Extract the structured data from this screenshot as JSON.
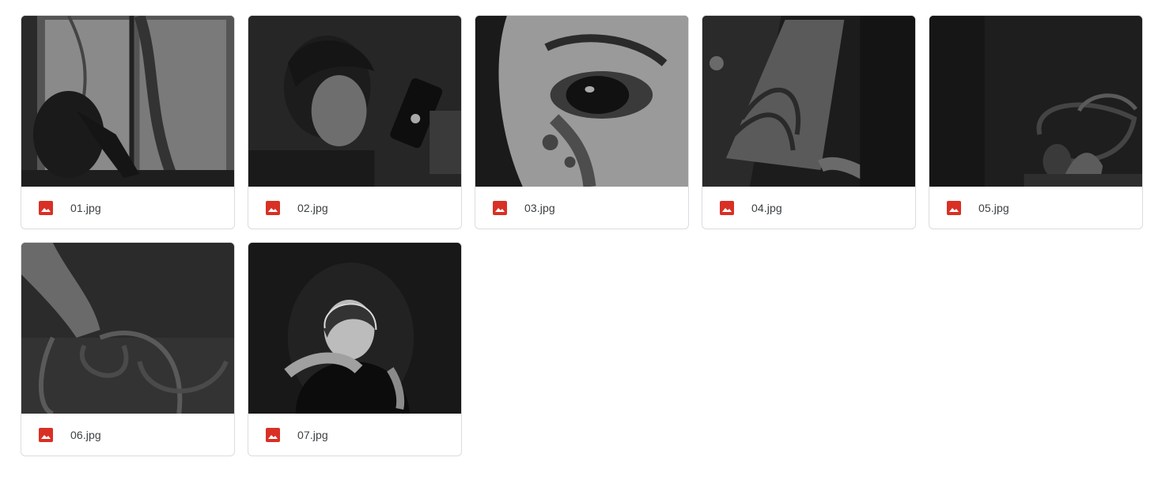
{
  "files": [
    {
      "name": "01.jpg",
      "icon": "image-file-icon",
      "thumbnail": "woman-sitting-by-window"
    },
    {
      "name": "02.jpg",
      "icon": "image-file-icon",
      "thumbnail": "person-lying-with-phone"
    },
    {
      "name": "03.jpg",
      "icon": "image-file-icon",
      "thumbnail": "close-up-eye"
    },
    {
      "name": "04.jpg",
      "icon": "image-file-icon",
      "thumbnail": "hand-at-drawer"
    },
    {
      "name": "05.jpg",
      "icon": "image-file-icon",
      "thumbnail": "hand-holding-rope"
    },
    {
      "name": "06.jpg",
      "icon": "image-file-icon",
      "thumbnail": "hand-with-rope-loops"
    },
    {
      "name": "07.jpg",
      "icon": "image-file-icon",
      "thumbnail": "woman-hugging-herself"
    }
  ],
  "colors": {
    "icon_red": "#d93025",
    "border": "#dadce0",
    "text": "#3c4043"
  }
}
